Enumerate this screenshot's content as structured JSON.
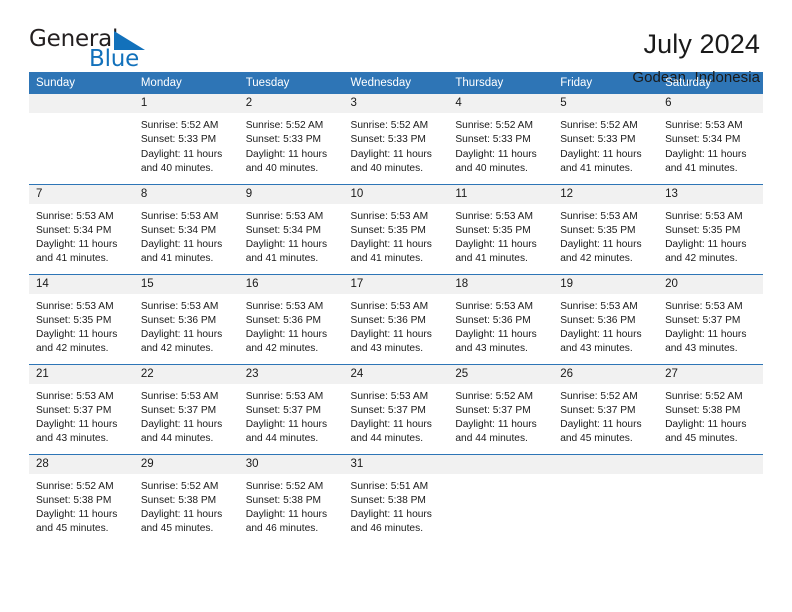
{
  "brand": {
    "word_one": "General",
    "word_two": "Blue",
    "accent_color": "#1271bb",
    "logo_icon": "triangle-icon"
  },
  "header": {
    "title": "July 2024",
    "subtitle": "Godean, Indonesia"
  },
  "theme": {
    "header_blue": "#2e75b6",
    "daynum_band": "#f1f1f1",
    "text": "#1a1a1a"
  },
  "columns": [
    "Sunday",
    "Monday",
    "Tuesday",
    "Wednesday",
    "Thursday",
    "Friday",
    "Saturday"
  ],
  "weeks": [
    [
      {
        "day": "",
        "sunrise": "",
        "sunset": "",
        "daylight_line1": "",
        "daylight_line2": ""
      },
      {
        "day": "1",
        "sunrise": "Sunrise: 5:52 AM",
        "sunset": "Sunset: 5:33 PM",
        "daylight_line1": "Daylight: 11 hours",
        "daylight_line2": "and 40 minutes."
      },
      {
        "day": "2",
        "sunrise": "Sunrise: 5:52 AM",
        "sunset": "Sunset: 5:33 PM",
        "daylight_line1": "Daylight: 11 hours",
        "daylight_line2": "and 40 minutes."
      },
      {
        "day": "3",
        "sunrise": "Sunrise: 5:52 AM",
        "sunset": "Sunset: 5:33 PM",
        "daylight_line1": "Daylight: 11 hours",
        "daylight_line2": "and 40 minutes."
      },
      {
        "day": "4",
        "sunrise": "Sunrise: 5:52 AM",
        "sunset": "Sunset: 5:33 PM",
        "daylight_line1": "Daylight: 11 hours",
        "daylight_line2": "and 40 minutes."
      },
      {
        "day": "5",
        "sunrise": "Sunrise: 5:52 AM",
        "sunset": "Sunset: 5:33 PM",
        "daylight_line1": "Daylight: 11 hours",
        "daylight_line2": "and 41 minutes."
      },
      {
        "day": "6",
        "sunrise": "Sunrise: 5:53 AM",
        "sunset": "Sunset: 5:34 PM",
        "daylight_line1": "Daylight: 11 hours",
        "daylight_line2": "and 41 minutes."
      }
    ],
    [
      {
        "day": "7",
        "sunrise": "Sunrise: 5:53 AM",
        "sunset": "Sunset: 5:34 PM",
        "daylight_line1": "Daylight: 11 hours",
        "daylight_line2": "and 41 minutes."
      },
      {
        "day": "8",
        "sunrise": "Sunrise: 5:53 AM",
        "sunset": "Sunset: 5:34 PM",
        "daylight_line1": "Daylight: 11 hours",
        "daylight_line2": "and 41 minutes."
      },
      {
        "day": "9",
        "sunrise": "Sunrise: 5:53 AM",
        "sunset": "Sunset: 5:34 PM",
        "daylight_line1": "Daylight: 11 hours",
        "daylight_line2": "and 41 minutes."
      },
      {
        "day": "10",
        "sunrise": "Sunrise: 5:53 AM",
        "sunset": "Sunset: 5:35 PM",
        "daylight_line1": "Daylight: 11 hours",
        "daylight_line2": "and 41 minutes."
      },
      {
        "day": "11",
        "sunrise": "Sunrise: 5:53 AM",
        "sunset": "Sunset: 5:35 PM",
        "daylight_line1": "Daylight: 11 hours",
        "daylight_line2": "and 41 minutes."
      },
      {
        "day": "12",
        "sunrise": "Sunrise: 5:53 AM",
        "sunset": "Sunset: 5:35 PM",
        "daylight_line1": "Daylight: 11 hours",
        "daylight_line2": "and 42 minutes."
      },
      {
        "day": "13",
        "sunrise": "Sunrise: 5:53 AM",
        "sunset": "Sunset: 5:35 PM",
        "daylight_line1": "Daylight: 11 hours",
        "daylight_line2": "and 42 minutes."
      }
    ],
    [
      {
        "day": "14",
        "sunrise": "Sunrise: 5:53 AM",
        "sunset": "Sunset: 5:35 PM",
        "daylight_line1": "Daylight: 11 hours",
        "daylight_line2": "and 42 minutes."
      },
      {
        "day": "15",
        "sunrise": "Sunrise: 5:53 AM",
        "sunset": "Sunset: 5:36 PM",
        "daylight_line1": "Daylight: 11 hours",
        "daylight_line2": "and 42 minutes."
      },
      {
        "day": "16",
        "sunrise": "Sunrise: 5:53 AM",
        "sunset": "Sunset: 5:36 PM",
        "daylight_line1": "Daylight: 11 hours",
        "daylight_line2": "and 42 minutes."
      },
      {
        "day": "17",
        "sunrise": "Sunrise: 5:53 AM",
        "sunset": "Sunset: 5:36 PM",
        "daylight_line1": "Daylight: 11 hours",
        "daylight_line2": "and 43 minutes."
      },
      {
        "day": "18",
        "sunrise": "Sunrise: 5:53 AM",
        "sunset": "Sunset: 5:36 PM",
        "daylight_line1": "Daylight: 11 hours",
        "daylight_line2": "and 43 minutes."
      },
      {
        "day": "19",
        "sunrise": "Sunrise: 5:53 AM",
        "sunset": "Sunset: 5:36 PM",
        "daylight_line1": "Daylight: 11 hours",
        "daylight_line2": "and 43 minutes."
      },
      {
        "day": "20",
        "sunrise": "Sunrise: 5:53 AM",
        "sunset": "Sunset: 5:37 PM",
        "daylight_line1": "Daylight: 11 hours",
        "daylight_line2": "and 43 minutes."
      }
    ],
    [
      {
        "day": "21",
        "sunrise": "Sunrise: 5:53 AM",
        "sunset": "Sunset: 5:37 PM",
        "daylight_line1": "Daylight: 11 hours",
        "daylight_line2": "and 43 minutes."
      },
      {
        "day": "22",
        "sunrise": "Sunrise: 5:53 AM",
        "sunset": "Sunset: 5:37 PM",
        "daylight_line1": "Daylight: 11 hours",
        "daylight_line2": "and 44 minutes."
      },
      {
        "day": "23",
        "sunrise": "Sunrise: 5:53 AM",
        "sunset": "Sunset: 5:37 PM",
        "daylight_line1": "Daylight: 11 hours",
        "daylight_line2": "and 44 minutes."
      },
      {
        "day": "24",
        "sunrise": "Sunrise: 5:53 AM",
        "sunset": "Sunset: 5:37 PM",
        "daylight_line1": "Daylight: 11 hours",
        "daylight_line2": "and 44 minutes."
      },
      {
        "day": "25",
        "sunrise": "Sunrise: 5:52 AM",
        "sunset": "Sunset: 5:37 PM",
        "daylight_line1": "Daylight: 11 hours",
        "daylight_line2": "and 44 minutes."
      },
      {
        "day": "26",
        "sunrise": "Sunrise: 5:52 AM",
        "sunset": "Sunset: 5:37 PM",
        "daylight_line1": "Daylight: 11 hours",
        "daylight_line2": "and 45 minutes."
      },
      {
        "day": "27",
        "sunrise": "Sunrise: 5:52 AM",
        "sunset": "Sunset: 5:38 PM",
        "daylight_line1": "Daylight: 11 hours",
        "daylight_line2": "and 45 minutes."
      }
    ],
    [
      {
        "day": "28",
        "sunrise": "Sunrise: 5:52 AM",
        "sunset": "Sunset: 5:38 PM",
        "daylight_line1": "Daylight: 11 hours",
        "daylight_line2": "and 45 minutes."
      },
      {
        "day": "29",
        "sunrise": "Sunrise: 5:52 AM",
        "sunset": "Sunset: 5:38 PM",
        "daylight_line1": "Daylight: 11 hours",
        "daylight_line2": "and 45 minutes."
      },
      {
        "day": "30",
        "sunrise": "Sunrise: 5:52 AM",
        "sunset": "Sunset: 5:38 PM",
        "daylight_line1": "Daylight: 11 hours",
        "daylight_line2": "and 46 minutes."
      },
      {
        "day": "31",
        "sunrise": "Sunrise: 5:51 AM",
        "sunset": "Sunset: 5:38 PM",
        "daylight_line1": "Daylight: 11 hours",
        "daylight_line2": "and 46 minutes."
      },
      {
        "day": "",
        "sunrise": "",
        "sunset": "",
        "daylight_line1": "",
        "daylight_line2": ""
      },
      {
        "day": "",
        "sunrise": "",
        "sunset": "",
        "daylight_line1": "",
        "daylight_line2": ""
      },
      {
        "day": "",
        "sunrise": "",
        "sunset": "",
        "daylight_line1": "",
        "daylight_line2": ""
      }
    ]
  ]
}
